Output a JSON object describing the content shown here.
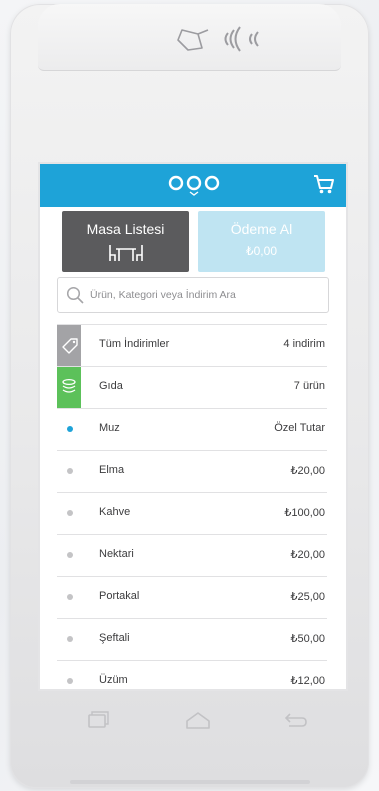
{
  "header": {
    "colors": {
      "primary": "#1ea3d8",
      "dark_button": "#5b5b5d",
      "light_button": "#bfe4f2"
    },
    "logo_icon": "ooo-logo-icon",
    "cart_icon": "shopping-cart-icon"
  },
  "buttons": {
    "table_list": {
      "label": "Masa Listesi",
      "icon": "table-chairs-icon"
    },
    "payment": {
      "label": "Ödeme Al",
      "amount": "₺0,00"
    }
  },
  "search": {
    "placeholder": "Ürün, Kategori veya İndirim Ara",
    "value": ""
  },
  "list": [
    {
      "name": "Tüm İndirimler",
      "value": "4 indirim",
      "icon": "discount-tag-icon"
    },
    {
      "name": "Gıda",
      "value": "7  ürün",
      "icon": "food-layers-icon"
    },
    {
      "name": "Muz",
      "value": "Özel Tutar",
      "icon": "bullet-dot-icon"
    },
    {
      "name": "Elma",
      "value": "₺20,00",
      "icon": "bullet-dot-icon"
    },
    {
      "name": "Kahve",
      "value": "₺100,00",
      "icon": "bullet-dot-icon"
    },
    {
      "name": "Nektari",
      "value": "₺20,00",
      "icon": "bullet-dot-icon"
    },
    {
      "name": "Portakal",
      "value": "₺25,00",
      "icon": "bullet-dot-icon"
    },
    {
      "name": "Şeftali",
      "value": "₺50,00",
      "icon": "bullet-dot-icon"
    },
    {
      "name": "Üzüm",
      "value": "₺12,00",
      "icon": "bullet-dot-icon"
    }
  ],
  "nav": {
    "recent_icon": "recent-apps-icon",
    "home_icon": "home-icon",
    "back_icon": "back-icon"
  }
}
